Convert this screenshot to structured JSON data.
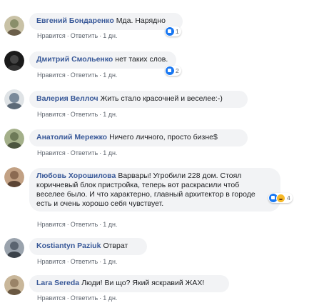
{
  "comments": [
    {
      "author": "Евгений Бондаренко",
      "text": "Мда. Нарядно",
      "like": "Нравится",
      "reply": "Ответить",
      "time": "1 дн.",
      "reactions": "1",
      "avatar_color": "#8a8f6a"
    },
    {
      "author": "Дмитрий Смольенко",
      "text": "нет таких слов.",
      "like": "Нравится",
      "reply": "Ответить",
      "time": "1 дн.",
      "reactions": "2",
      "avatar_color": "#2e2e2e"
    },
    {
      "author": "Валерия Веллоч",
      "text": "Жить стало красочней и веселее:-)",
      "like": "Нравится",
      "reply": "Ответить",
      "time": "1 дн.",
      "avatar_color": "#7a8a9a"
    },
    {
      "author": "Анатолий Мережко",
      "text": "Ничего личного, просто бизне$",
      "like": "Нравится",
      "reply": "Ответить",
      "time": "1 дн.",
      "avatar_color": "#6d7a58"
    },
    {
      "author": "Любовь Хорошилова",
      "text_lines": [
        "Варвары! Угробили 228 дом. Стоял",
        "коричневый блок пристройка, теперь вот раскрасили чтоб",
        "веселее было. И что характерно, главный архитектор в городе",
        "есть и очень хорошо себя чувствует."
      ],
      "like": "Нравится",
      "reply": "Ответить",
      "time": "1 дн.",
      "reactions": "4",
      "avatar_color": "#8b6a52"
    },
    {
      "author": "Kostiantyn Paziuk",
      "text": "Отврат",
      "like": "Нравится",
      "reply": "Ответить",
      "time": "1 дн.",
      "avatar_color": "#5a6470"
    },
    {
      "author": "Lara Sereda",
      "text": "Люди! Ви що? Який яскравий ЖАХ!",
      "like": "Нравится",
      "reply": "Ответить",
      "time": "1 дн.",
      "avatar_color": "#9a8468"
    }
  ]
}
